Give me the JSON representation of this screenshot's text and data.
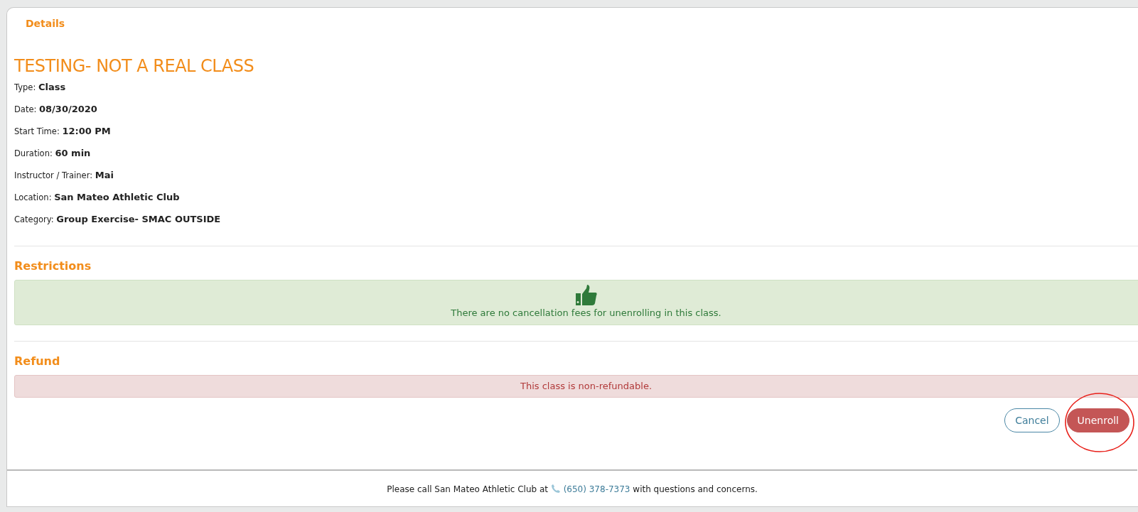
{
  "details": {
    "heading": "Details",
    "title": "TESTING- NOT A REAL CLASS",
    "fields": [
      {
        "label": "Type:",
        "value": "Class"
      },
      {
        "label": "Date:",
        "value": "08/30/2020"
      },
      {
        "label": "Start Time:",
        "value": "12:00 PM"
      },
      {
        "label": "Duration:",
        "value": "60 min"
      },
      {
        "label": "Instructor / Trainer:",
        "value": "Mai"
      },
      {
        "label": "Location:",
        "value": "San Mateo Athletic Club"
      },
      {
        "label": "Category:",
        "value": "Group Exercise- SMAC OUTSIDE"
      }
    ]
  },
  "restrictions": {
    "heading": "Restrictions",
    "kind": "success",
    "message": "There are no cancellation fees for unenrolling in this class."
  },
  "refund": {
    "heading": "Refund",
    "kind": "danger",
    "message": "This class is non-refundable."
  },
  "buttons": [
    {
      "label": "Cancel",
      "kind": "outline"
    },
    {
      "label": "Unenroll",
      "kind": "danger"
    }
  ],
  "footer": {
    "before": "Please call San Mateo Athletic Club at",
    "phone": "(650) 378-7373",
    "after": "with questions and concerns."
  }
}
